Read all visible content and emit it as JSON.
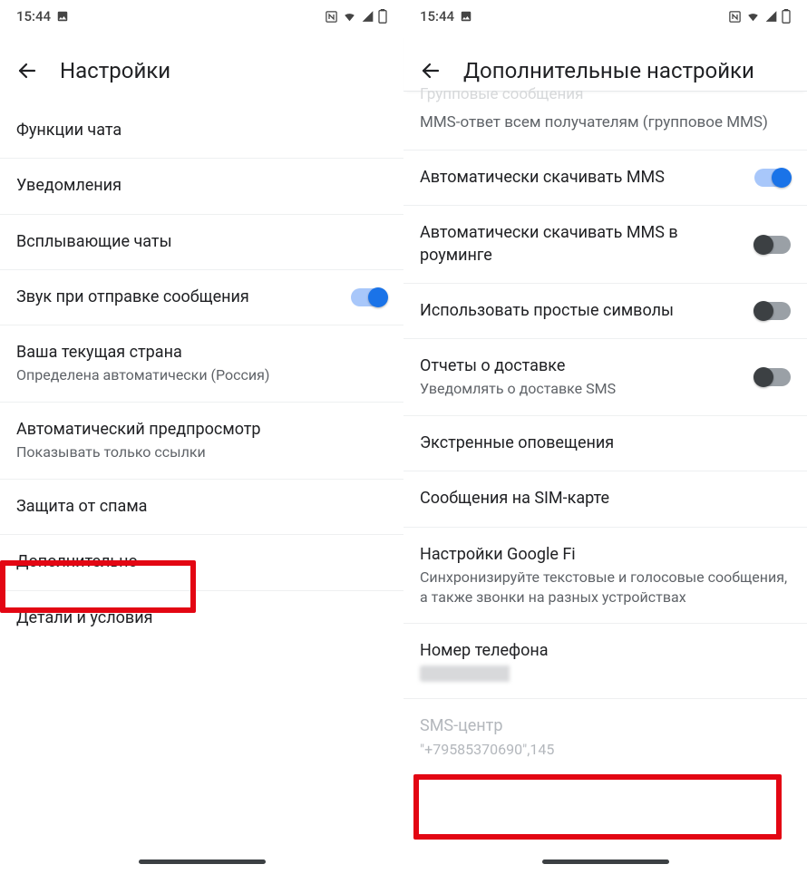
{
  "statusbar": {
    "time": "15:44"
  },
  "left": {
    "title": "Настройки",
    "items": {
      "chat_features": "Функции чата",
      "notifications": "Уведомления",
      "bubbles": "Всплывающие чаты",
      "sound_on_send": "Звук при отправке сообщения",
      "country_title": "Ваша текущая страна",
      "country_sub": "Определена автоматически (Россия)",
      "preview_title": "Автоматический предпросмотр",
      "preview_sub": "Показывать только ссылки",
      "spam": "Защита от спама",
      "advanced": "Дополнительно",
      "terms": "Детали и условия"
    }
  },
  "right": {
    "title": "Дополнительные настройки",
    "ghost_prev": "Групповые сообщения",
    "items": {
      "mms_reply_title": "MMS-ответ всем получателям (групповое MMS)",
      "auto_dl_mms": "Автоматически скачивать MMS",
      "auto_dl_roaming": "Автоматически скачивать MMS в роуминге",
      "simple_chars": "Использовать простые символы",
      "delivery_title": "Отчеты о доставке",
      "delivery_sub": "Уведомлять о доставке SMS",
      "emergency": "Экстренные оповещения",
      "sim_messages": "Сообщения на SIM-карте",
      "googlefi_title": "Настройки Google Fi",
      "googlefi_sub": "Синхронизируйте текстовые и голосовые сообщения, а также звонки на разных устройствах",
      "phone_title": "Номер телефона",
      "smsc_title": "SMS-центр",
      "smsc_value": "\"+79585370690\",145"
    }
  }
}
